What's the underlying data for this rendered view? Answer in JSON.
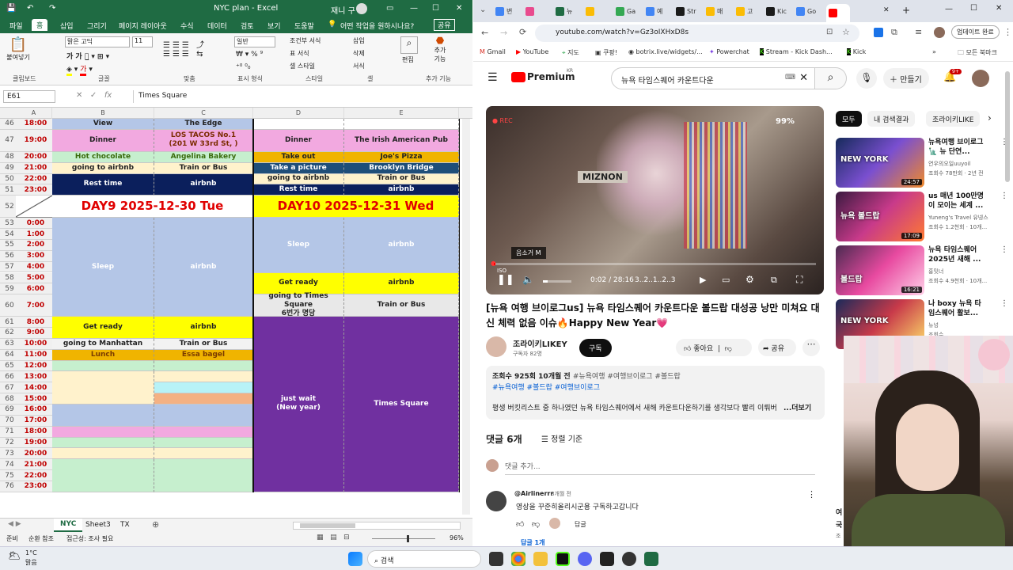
{
  "excel": {
    "title": "NYC plan  -  Excel",
    "user": "재니 구",
    "menu": [
      "파일",
      "홈",
      "삽입",
      "그리기",
      "페이지 레이아웃",
      "수식",
      "데이터",
      "검토",
      "보기",
      "도움말"
    ],
    "tell_me": "어떤 작업을 원하시나요?",
    "share": "공유",
    "font_name": "맑은 고딕",
    "font_size": "11",
    "number_format": "일반",
    "ribbon_groups": [
      "클립보드",
      "글꼴",
      "맞춤",
      "표시 형식",
      "스타일",
      "셀",
      "편집",
      "추가 기능"
    ],
    "ribbon_buttons": {
      "paste": "붙여넣기",
      "cond_format": "조건부 서식",
      "table_format": "표 서식",
      "cell_style": "셀 스타일",
      "insert": "삽입",
      "delete": "삭제",
      "format": "서식",
      "edit": "편집",
      "addins": "추가 기능"
    },
    "name_box": "E61",
    "formula": "Times Square",
    "columns": [
      "A",
      "B",
      "C",
      "D",
      "E"
    ],
    "rows": [
      {
        "n": "46",
        "t": "18:00",
        "b": "View",
        "c": "The Edge",
        "d": "",
        "e": ""
      },
      {
        "n": "47",
        "t": "19:00",
        "b": "Dinner",
        "c": "LOS TACOS No.1\n(201 W 33rd St, )",
        "d": "Dinner",
        "e": "The Irish American Pub"
      },
      {
        "n": "48",
        "t": "20:00",
        "b": "Hot chocolate",
        "c": "Angelina Bakery",
        "d": "Take out",
        "e": "Joe's Pizza"
      },
      {
        "n": "49",
        "t": "21:00",
        "b": "going to airbnb",
        "c": "Train or Bus",
        "d": "Take a picture",
        "e": "Brooklyn Bridge"
      },
      {
        "n": "50",
        "t": "22:00",
        "b": "Rest time",
        "c": "airbnb",
        "d": "going to airbnb",
        "e": "Train or Bus"
      },
      {
        "n": "51",
        "t": "23:00",
        "b": "",
        "c": "",
        "d": "Rest time",
        "e": "airbnb"
      },
      {
        "n": "52",
        "t": "",
        "b": "DAY9  2025-12-30 Tue",
        "c": "",
        "d": "DAY10  2025-12-31 Wed",
        "e": ""
      },
      {
        "n": "53",
        "t": "0:00",
        "b": "Sleep",
        "c": "airbnb",
        "d": "Sleep",
        "e": "airbnb"
      },
      {
        "n": "54",
        "t": "1:00"
      },
      {
        "n": "55",
        "t": "2:00"
      },
      {
        "n": "56",
        "t": "3:00"
      },
      {
        "n": "57",
        "t": "4:00"
      },
      {
        "n": "58",
        "t": "5:00",
        "d": "Get ready",
        "e": "airbnb"
      },
      {
        "n": "59",
        "t": "6:00"
      },
      {
        "n": "60",
        "t": "7:00",
        "d": "going to Times Square\n6번가 명당",
        "e": "Train or Bus"
      },
      {
        "n": "61",
        "t": "8:00",
        "b": "Get ready",
        "c": "airbnb",
        "d": "just wait\n(New year)",
        "e": "Times Square"
      },
      {
        "n": "62",
        "t": "9:00"
      },
      {
        "n": "63",
        "t": "10:00",
        "b": "going to Manhattan",
        "c": "Train or Bus"
      },
      {
        "n": "64",
        "t": "11:00",
        "b": "Lunch",
        "c": "Essa bagel"
      },
      {
        "n": "65",
        "t": "12:00"
      },
      {
        "n": "66",
        "t": "13:00"
      },
      {
        "n": "67",
        "t": "14:00"
      },
      {
        "n": "68",
        "t": "15:00"
      },
      {
        "n": "69",
        "t": "16:00"
      },
      {
        "n": "70",
        "t": "17:00"
      },
      {
        "n": "71",
        "t": "18:00"
      },
      {
        "n": "72",
        "t": "19:00"
      },
      {
        "n": "73",
        "t": "20:00"
      },
      {
        "n": "74",
        "t": "21:00"
      },
      {
        "n": "75",
        "t": "22:00"
      },
      {
        "n": "76",
        "t": "23:00"
      }
    ],
    "sheets": [
      "NYC",
      "Sheet3",
      "TX"
    ],
    "status": {
      "ready": "준비",
      "circular": "순환 참조",
      "accessibility": "접근성: 조사 필요",
      "zoom": "96%"
    }
  },
  "chrome": {
    "tabs": [
      "변",
      "",
      "뉴",
      "",
      "Ga",
      "예",
      "Str",
      "매",
      "고",
      "Kic",
      "Go",
      ""
    ],
    "url": "youtube.com/watch?v=Gz3oIXHxD8s",
    "update_btn": "업데이트 완료",
    "bookmarks": [
      "Gmail",
      "YouTube",
      "지도",
      "쿠팡!",
      "botrix.live/widgets/...",
      "Powerchat",
      "Stream - Kick Dash...",
      "Kick"
    ],
    "all_bookmarks": "모든 북마크",
    "yt": {
      "logo": "Premium",
      "region": "KR",
      "search": "뉴욕 타임스퀘어 카운트다운",
      "create": "만들기",
      "notif": "9+",
      "video_title": "[뉴욕 여행 브이로그us] 뉴욕 타임스퀘어 카운트다운 볼드랍 대성공 낭만 미쳐요 대신 체력 없음 이슈🔥Happy New Year💗",
      "time": "0:02 / 28:16",
      "chapter": "3..2..1..2..3",
      "volume_tip": "음소거 M",
      "rec": "REC",
      "battery": "99%",
      "sign": "MIZNON",
      "iso": "ISO",
      "channel": "조라이키LIKEY",
      "subs": "구독자 82명",
      "subscribe": "구독",
      "like": "좋아요",
      "share": "공유",
      "views": "조회수 925회  10개월 전",
      "tags1": "#뉴욕여행 #여행브이로그 #볼드랍",
      "tags2": "#뉴욕여행 #볼드랍 #여행브이로그",
      "desc": "평생 버킷리스트 중 하나였던 뉴욕 타임스퀘어에서 새해 카운트다운하기를 생각보다 빨리 이뤄버",
      "more": "...더보기",
      "comments_count": "댓글 6개",
      "sort": "정렬 기준",
      "add_comment": "댓글 추가...",
      "comment_user": "@Airlinerrr",
      "comment_time": "8개월 전",
      "comment_text": "영상을 꾸준히올리시군용 구독하고갑니다",
      "reply": "답글",
      "replies": "답글 1개",
      "chips": [
        "모두",
        "내 검색결과",
        "조라이키LIKE"
      ],
      "side": [
        {
          "title": "뉴욕여행 브이로그 🗽 뉴 단연...",
          "ch": "연우의오일uuyoil",
          "meta": "조회수 78만회 · 2년 전",
          "dur": "24:57",
          "thumb": "NEW YORK"
        },
        {
          "title": "us 매년 100만명이 모이는 세계 ...",
          "ch": "Yuneng's Travel 유넹스",
          "meta": "조회수 1.2천회 · 10개...",
          "dur": "17:09",
          "thumb": "뉴욕 볼드랍"
        },
        {
          "title": "뉴욕 타임스퀘어 2025년 새해 ...",
          "ch": "홍밋너",
          "meta": "조회수 4.9천회 · 10개...",
          "dur": "16:21",
          "thumb": "볼드랍"
        },
        {
          "title": "나 boxy 뉴욕 타임스퀘어 활보...",
          "ch": "뉴넝",
          "meta": "조회수 ...",
          "dur": "",
          "thumb": "NEW YORK"
        }
      ],
      "side_more": [
        "여",
        "국",
        "조"
      ]
    }
  },
  "taskbar": {
    "temp": "1°C",
    "weather": "맑음",
    "search": "검색"
  },
  "colors": {
    "excel_green": "#1f6b43",
    "pink": "#f2a9e0",
    "green_light": "#c6efce",
    "navy": "#0b1f5c",
    "teal": "#1f4e79",
    "yellow": "#ffff00",
    "lavender": "#b4c6e7",
    "purple": "#7030a0",
    "orange": "#f4a261",
    "gold": "#f0b400",
    "cream": "#fff2cc",
    "aqua": "#b7f2f7",
    "salmon": "#f4b183",
    "yt_red": "#ff0000"
  }
}
